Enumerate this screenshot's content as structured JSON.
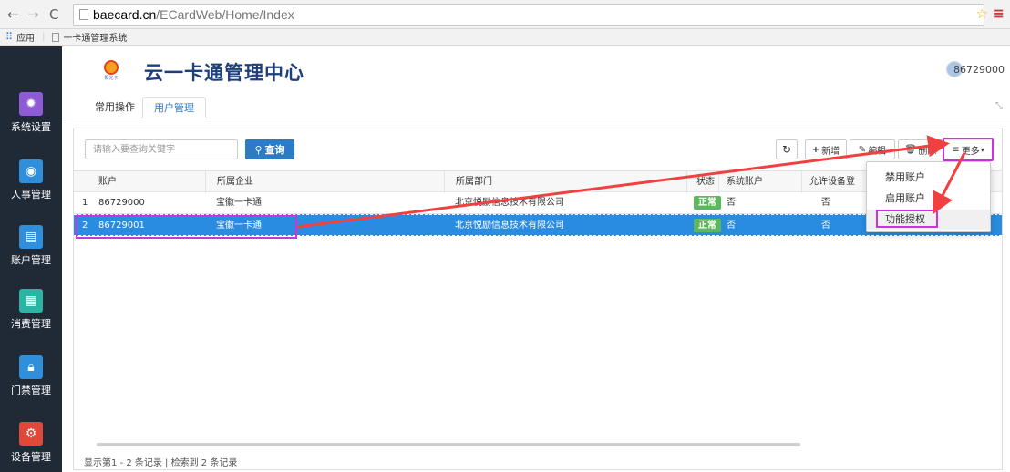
{
  "browser": {
    "url_host": "baecard.cn",
    "url_path": "/ECardWeb/Home/Index",
    "apps_label": "应用",
    "bookmark_label": "一卡通管理系统"
  },
  "sidebar": {
    "items": [
      {
        "label": "系统设置",
        "icon": "gear-icon",
        "color": "#8e5ad6"
      },
      {
        "label": "人事管理",
        "icon": "user-icon",
        "color": "#2f8fdb"
      },
      {
        "label": "账户管理",
        "icon": "id-card-icon",
        "color": "#2f8fdb"
      },
      {
        "label": "消费管理",
        "icon": "calculator-icon",
        "color": "#2bb4a3"
      },
      {
        "label": "门禁管理",
        "icon": "lock-icon",
        "color": "#2f8fdb"
      },
      {
        "label": "设备管理",
        "icon": "cogs-icon",
        "color": "#e0483a"
      }
    ]
  },
  "header": {
    "logo_text": "阳光卡",
    "title": "云一卡通管理中心",
    "user": "86729000"
  },
  "tabs": [
    {
      "label": "常用操作",
      "active": false
    },
    {
      "label": "用户管理",
      "active": true
    }
  ],
  "toolbar": {
    "search_placeholder": "请输入要查询关键字",
    "query_label": "查询",
    "refresh_icon": "refresh-icon",
    "add_label": "新增",
    "edit_label": "编辑",
    "delete_label": "删除",
    "more_label": "更多"
  },
  "table": {
    "columns": [
      "账户",
      "所属企业",
      "所属部门",
      "状态",
      "系统账户",
      "允许设备登"
    ],
    "rows": [
      {
        "index": "1",
        "account": "86729000",
        "company": "宝徽一卡通",
        "dept": "北京悦励信息技术有限公司",
        "status": "正常",
        "system": "否",
        "allow": "否",
        "selected": false
      },
      {
        "index": "2",
        "account": "86729001",
        "company": "宝徽一卡通",
        "dept": "北京悦励信息技术有限公司",
        "status": "正常",
        "system": "否",
        "allow": "否",
        "selected": true
      }
    ]
  },
  "dropdown": {
    "items": [
      "禁用账户",
      "启用账户",
      "功能授权"
    ]
  },
  "footer": {
    "text": "显示第1 - 2 条记录 | 检索到 2 条记录"
  },
  "colors": {
    "accent": "#2b7bc6",
    "highlight": "#c934e0",
    "arrow": "#f04040",
    "sidebar_bg": "#1f2a36"
  }
}
